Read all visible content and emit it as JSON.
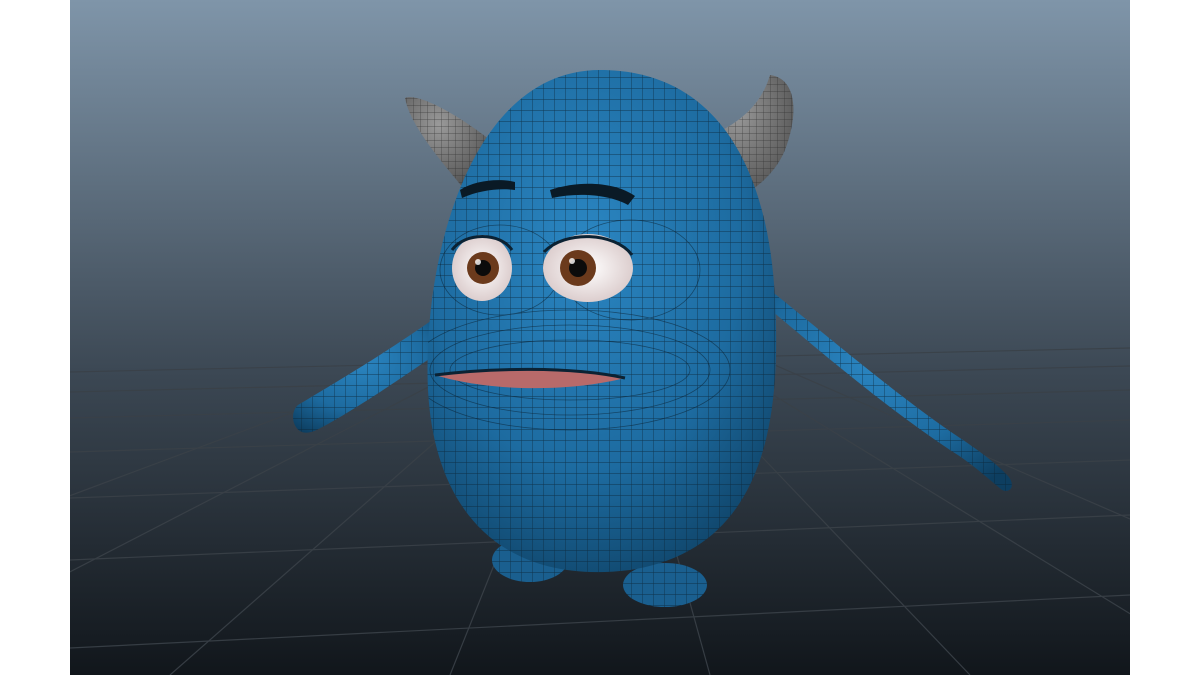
{
  "scene": {
    "kind": "3d-viewport-render",
    "subject": "blue-horned-monster-wireframe",
    "colors": {
      "sky_top": "#7f95a9",
      "sky_bottom": "#141a1f",
      "grid_line": "#3a4148",
      "body": "#1f6fa6",
      "body_shade": "#0e3f63",
      "horn": "#6f6f6f",
      "wire": "#0b2233",
      "eye_white": "#efe6e6",
      "iris": "#6b3a1c",
      "mouth": "#b86a6a"
    }
  }
}
